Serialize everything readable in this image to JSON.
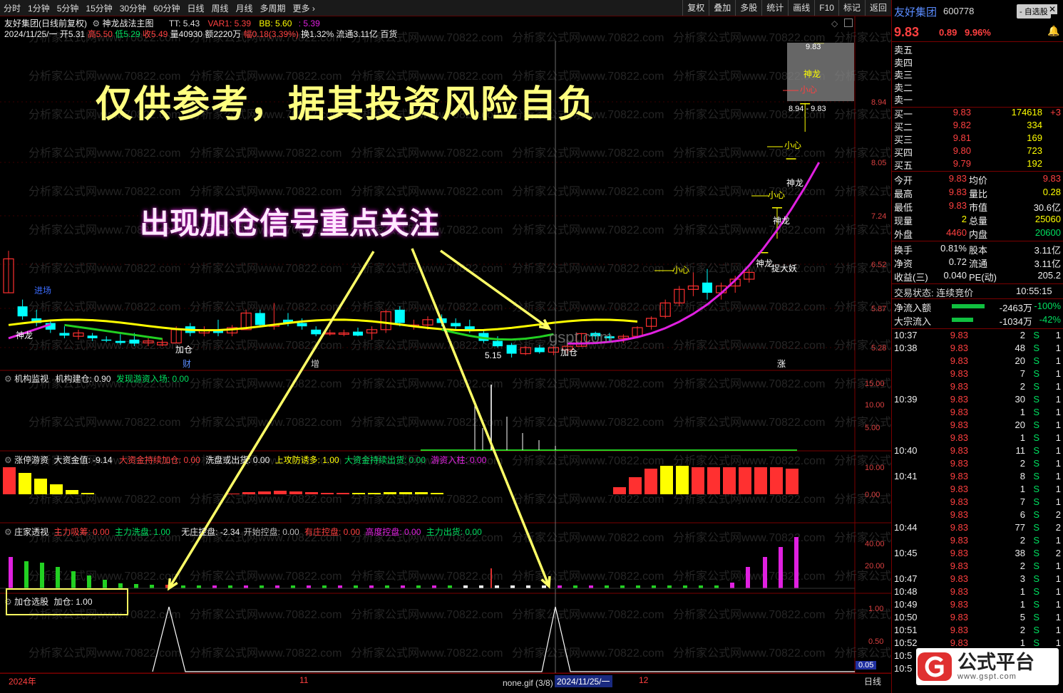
{
  "toolbar": {
    "timeframes": [
      "分时",
      "1分钟",
      "5分钟",
      "15分钟",
      "30分钟",
      "60分钟",
      "日线",
      "周线",
      "月线",
      "多周期",
      "更多 ›"
    ],
    "tools": [
      "复权",
      "叠加",
      "多股",
      "统计",
      "画线",
      "F10",
      "标记",
      "返回"
    ]
  },
  "header": {
    "name_line": "友好集团(日线前复权)",
    "indicator": "神龙战法主图",
    "tt": "TT: 5.43",
    "var1": "VAR1: 5.39",
    "bb": "BB: 5.60",
    "extra": ": 5.39",
    "quote_date": "2024/11/25/一",
    "quote_open": "开5.31",
    "quote_high": "高5.50",
    "quote_low": "低5.29",
    "quote_close": "收5.49",
    "quote_vol": "量40930",
    "quote_amt": "额2220万",
    "quote_chg": "幅0.18(3.39%)",
    "quote_turn": "换1.32%",
    "quote_float": "流通3.11亿",
    "quote_unit": "百货"
  },
  "overlay": {
    "disclaimer": "仅供参考，据其投资风险自负",
    "signal_note": "出现加仓信号重点关注",
    "watermark": "分析家公式网www.70822.com",
    "center_mark": "gspt.com"
  },
  "main_yaxis": [
    "8.94",
    "8.05",
    "7.24",
    "6.52",
    "5.87",
    "5.28"
  ],
  "main_labels": {
    "jinchang": "进场",
    "shenlong": "神龙",
    "jiacang": "加仓",
    "low_price": "5.15",
    "xiaoxin": "小心",
    "zhuodayao": "捉大妖",
    "range_top": "9.83",
    "range": "8.94 - 9.83",
    "cai": "财",
    "zeng": "增",
    "zhang": "涨"
  },
  "panel_jigou": {
    "name": "机构监视",
    "a": "机构建仓: 0.90",
    "b": "发现游资入场: 0.00",
    "yaxis": [
      "15.00",
      "10.00",
      "5.00"
    ]
  },
  "panel_zhangting": {
    "name": "涨停游资",
    "a": "大资金值: -9.14",
    "b": "大资金持续加仓: 0.00",
    "c": "洗盘或出货: 0.00",
    "d": "上攻防诱多: 1.00",
    "e": "大资金持续出货: 0.00",
    "f": "游资入柱: 0.00",
    "yaxis": [
      "10.00",
      "0.00"
    ]
  },
  "panel_zhuangjia": {
    "name": "庄家透视",
    "a": "主力吸筹: 0.00",
    "b": "主力洗盘: 1.00",
    "c": "无庄控盘: -2.34",
    "d": "开始控盘: 0.00",
    "e": "有庄控盘: 0.00",
    "f": "高度控盘: 0.00",
    "g": "主力出货: 0.00",
    "yaxis": [
      "40.00",
      "20.00"
    ]
  },
  "panel_jiacang": {
    "name": "加仓选股",
    "a": "加仓: 1.00",
    "yaxis": [
      "1.00",
      "0.50"
    ],
    "corner": "0.05"
  },
  "xaxis": {
    "year": "2024年",
    "m11": "11",
    "m12": "12",
    "file": "none.gif (3/8)",
    "cursor_date": "2024/11/25/一",
    "period": "日线"
  },
  "side": {
    "name": "友好集团",
    "code": "600778",
    "button": "- 自选股",
    "price": "9.83",
    "change": "0.89",
    "pct": "9.96%",
    "asks": [
      "卖五",
      "卖四",
      "卖三",
      "卖二",
      "卖一"
    ],
    "bids": [
      {
        "label": "买一",
        "price": "9.83",
        "vol": "174618",
        "ex": "+3"
      },
      {
        "label": "买二",
        "price": "9.82",
        "vol": "334",
        "ex": ""
      },
      {
        "label": "买三",
        "price": "9.81",
        "vol": "169",
        "ex": ""
      },
      {
        "label": "买四",
        "price": "9.80",
        "vol": "723",
        "ex": ""
      },
      {
        "label": "买五",
        "price": "9.79",
        "vol": "192",
        "ex": ""
      }
    ],
    "stats": [
      {
        "l1": "今开",
        "v1": "9.83",
        "l2": "均价",
        "v2": "9.83"
      },
      {
        "l1": "最高",
        "v1": "9.83",
        "l2": "量比",
        "v2": "0.28"
      },
      {
        "l1": "最低",
        "v1": "9.83",
        "l2": "市值",
        "v2": "30.6亿"
      },
      {
        "l1": "现量",
        "v1": "2",
        "l2": "总量",
        "v2": "25060"
      },
      {
        "l1": "外盘",
        "v1": "4460",
        "l2": "内盘",
        "v2": "20600"
      }
    ],
    "stats2": [
      {
        "l1": "换手",
        "v1": "0.81%",
        "l2": "股本",
        "v2": "3.11亿"
      },
      {
        "l1": "净资",
        "v1": "0.72",
        "l2": "流通",
        "v2": "3.11亿"
      },
      {
        "l1": "收益(三)",
        "v1": "0.040",
        "l2": "PE(动)",
        "v2": "205.2"
      }
    ],
    "trade_state": "交易状态: 连续竞价",
    "trade_time": "10:55:15",
    "flows": [
      {
        "label": "净流入额",
        "value": "-2463万",
        "pct": "-100%"
      },
      {
        "label": "大宗流入",
        "value": "-1034万",
        "pct": "-42%"
      }
    ],
    "ticks": [
      {
        "t": "10:37",
        "p": "9.83",
        "v": "2",
        "s": "S",
        "n": "1"
      },
      {
        "t": "10:38",
        "p": "9.83",
        "v": "48",
        "s": "S",
        "n": "1"
      },
      {
        "t": "",
        "p": "9.83",
        "v": "20",
        "s": "S",
        "n": "1"
      },
      {
        "t": "",
        "p": "9.83",
        "v": "7",
        "s": "S",
        "n": "1"
      },
      {
        "t": "",
        "p": "9.83",
        "v": "2",
        "s": "S",
        "n": "1"
      },
      {
        "t": "10:39",
        "p": "9.83",
        "v": "30",
        "s": "S",
        "n": "1"
      },
      {
        "t": "",
        "p": "9.83",
        "v": "1",
        "s": "S",
        "n": "1"
      },
      {
        "t": "",
        "p": "9.83",
        "v": "20",
        "s": "S",
        "n": "1"
      },
      {
        "t": "",
        "p": "9.83",
        "v": "1",
        "s": "S",
        "n": "1"
      },
      {
        "t": "10:40",
        "p": "9.83",
        "v": "11",
        "s": "S",
        "n": "1"
      },
      {
        "t": "",
        "p": "9.83",
        "v": "2",
        "s": "S",
        "n": "1"
      },
      {
        "t": "10:41",
        "p": "9.83",
        "v": "8",
        "s": "S",
        "n": "1"
      },
      {
        "t": "",
        "p": "9.83",
        "v": "1",
        "s": "S",
        "n": "1"
      },
      {
        "t": "",
        "p": "9.83",
        "v": "7",
        "s": "S",
        "n": "1"
      },
      {
        "t": "",
        "p": "9.83",
        "v": "6",
        "s": "S",
        "n": "2"
      },
      {
        "t": "10:44",
        "p": "9.83",
        "v": "77",
        "s": "S",
        "n": "2"
      },
      {
        "t": "",
        "p": "9.83",
        "v": "2",
        "s": "S",
        "n": "1"
      },
      {
        "t": "10:45",
        "p": "9.83",
        "v": "38",
        "s": "S",
        "n": "2"
      },
      {
        "t": "",
        "p": "9.83",
        "v": "2",
        "s": "S",
        "n": "1"
      },
      {
        "t": "10:47",
        "p": "9.83",
        "v": "3",
        "s": "S",
        "n": "1"
      },
      {
        "t": "10:48",
        "p": "9.83",
        "v": "1",
        "s": "S",
        "n": "1"
      },
      {
        "t": "10:49",
        "p": "9.83",
        "v": "1",
        "s": "S",
        "n": "1"
      },
      {
        "t": "10:50",
        "p": "9.83",
        "v": "5",
        "s": "S",
        "n": "1"
      },
      {
        "t": "10:51",
        "p": "9.83",
        "v": "2",
        "s": "S",
        "n": "1"
      },
      {
        "t": "10:52",
        "p": "9.83",
        "v": "1",
        "s": "S",
        "n": "1"
      },
      {
        "t": "10:5",
        "p": "",
        "v": "",
        "s": "",
        "n": ""
      },
      {
        "t": "10:5",
        "p": "",
        "v": "",
        "s": "",
        "n": ""
      }
    ],
    "logo_text": "公式平台",
    "logo_url": "www.gspt.com"
  },
  "colors": {
    "up": "#ff3030",
    "down": "#00ffff",
    "yellow": "#ffff00",
    "magenta": "#e020e0",
    "green": "#20c020",
    "grid_red": "#7a0000"
  }
}
